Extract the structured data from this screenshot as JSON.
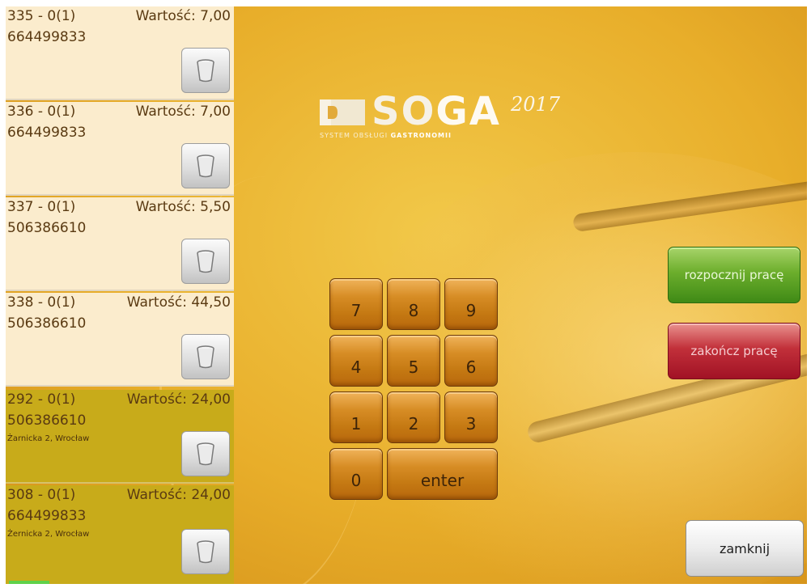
{
  "orders": [
    {
      "id": "335 - 0(1)",
      "value": "Wartość: 7,00",
      "phone": "664499833",
      "address": "",
      "type": "normal"
    },
    {
      "id": "336 - 0(1)",
      "value": "Wartość: 7,00",
      "phone": "664499833",
      "address": "",
      "type": "normal"
    },
    {
      "id": "337 - 0(1)",
      "value": "Wartość: 5,50",
      "phone": "506386610",
      "address": "",
      "type": "normal"
    },
    {
      "id": "338 - 0(1)",
      "value": "Wartość: 44,50",
      "phone": "506386610",
      "address": "",
      "type": "normal"
    },
    {
      "id": "292 - 0(1)",
      "value": "Wartość: 24,00",
      "phone": "506386610",
      "address": "Żarnicka 2, Wrocław",
      "type": "delivery"
    },
    {
      "id": "308 - 0(1)",
      "value": "Wartość: 24,00",
      "phone": "664499833",
      "address": "Żernicka 2, Wrocław",
      "type": "delivery"
    }
  ],
  "delete_icon": "trash-icon",
  "logo": {
    "name_part1": "SO",
    "name_part2": "GA",
    "year": "2017",
    "subtitle_a": "SYSTEM OBSŁUGI",
    "subtitle_b": "GASTRONOMII"
  },
  "keypad": {
    "keys": [
      "7",
      "8",
      "9",
      "4",
      "5",
      "6",
      "1",
      "2",
      "3",
      "0"
    ],
    "enter": "enter"
  },
  "actions": {
    "start_label": "rozpocznij pracę",
    "end_label": "zakończ pracę",
    "close_label": "zamknij"
  },
  "colors": {
    "start": "#6cae2c",
    "end": "#c2303a",
    "order_normal": "#fbeccd",
    "order_delivery": "#c8ab1a"
  }
}
